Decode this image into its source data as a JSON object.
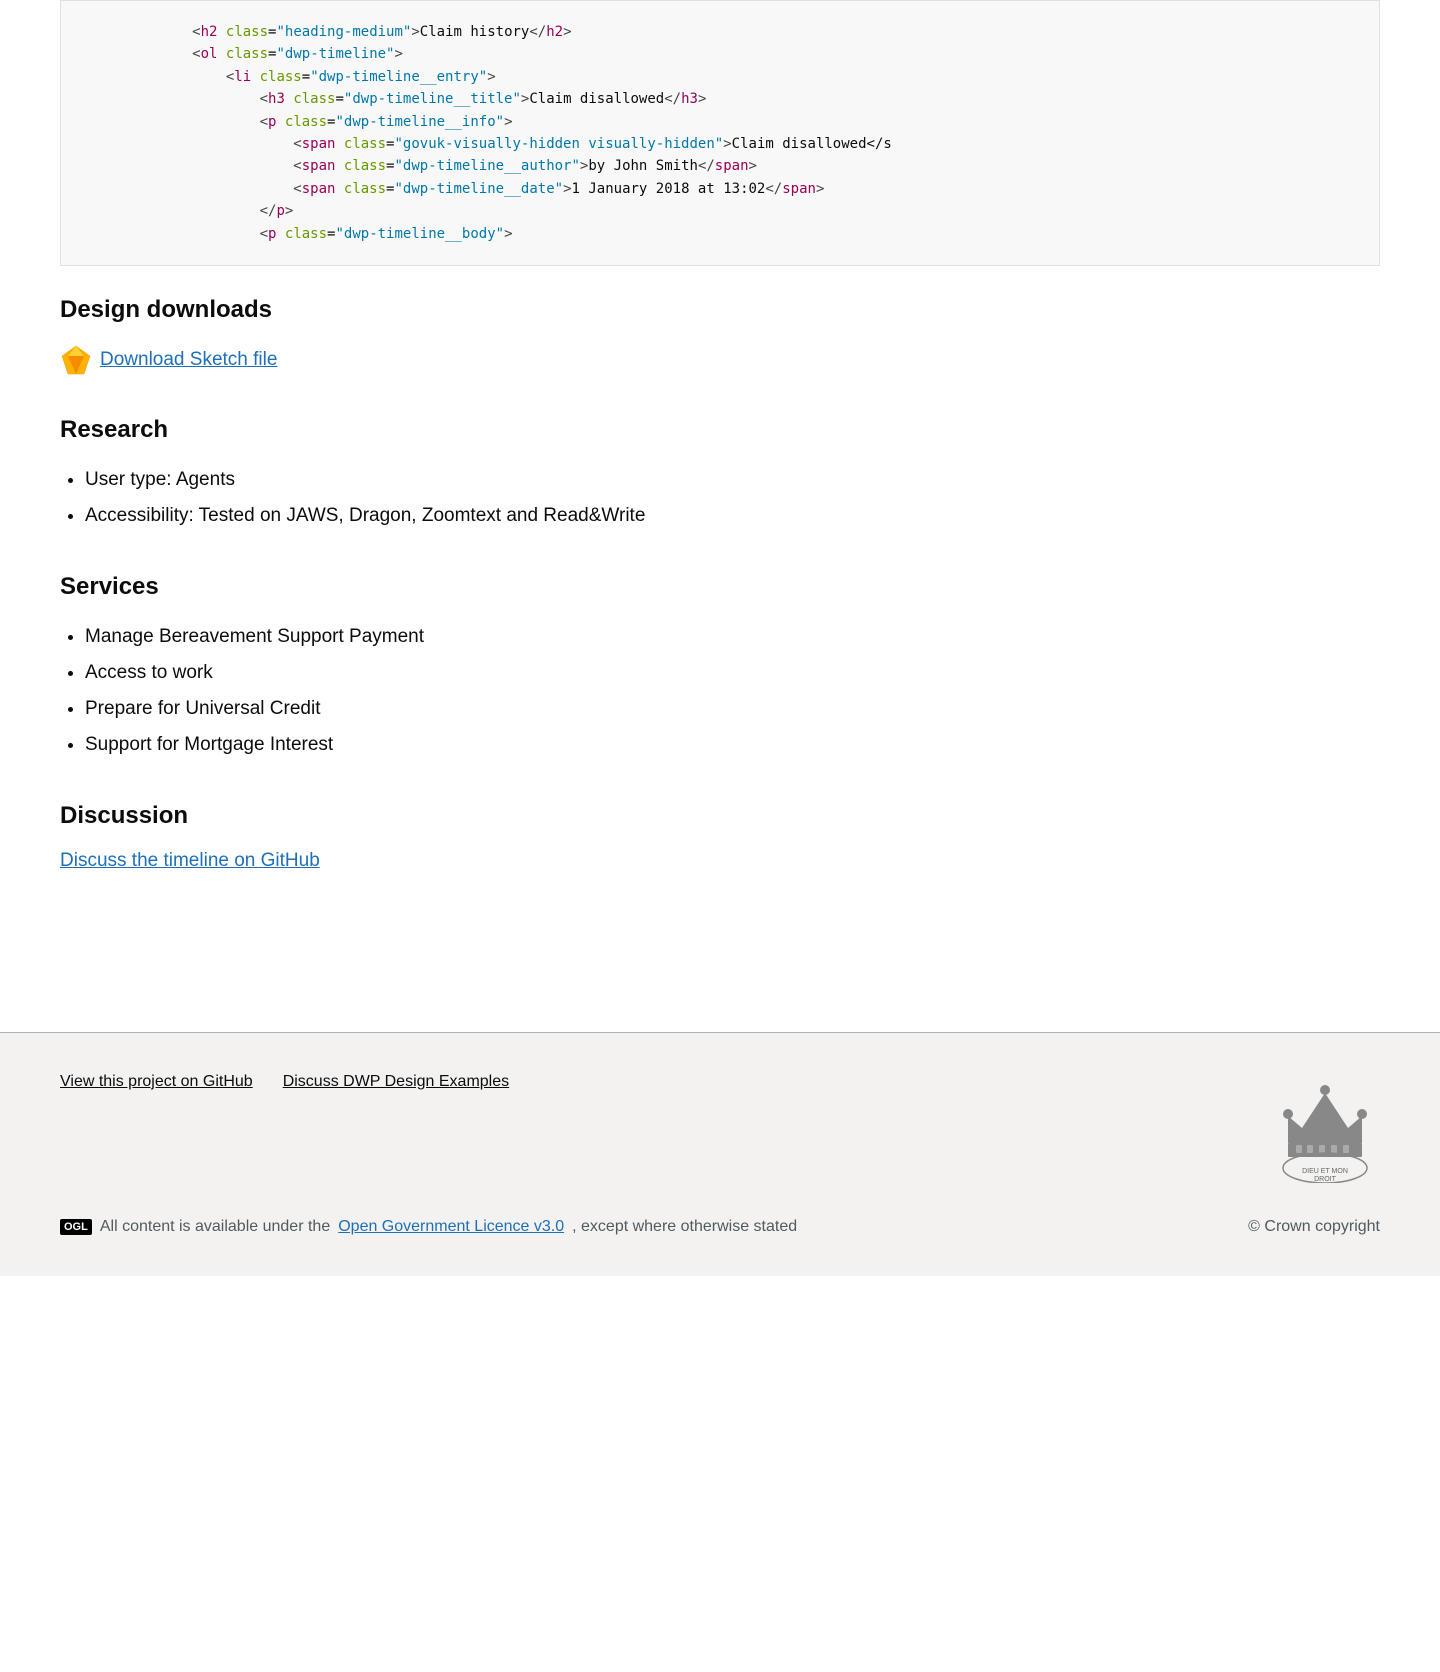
{
  "code_block": {
    "lines": [
      {
        "indent": 12,
        "content": "<h2 class=\"heading-medium\">Claim history</h2>"
      },
      {
        "indent": 12,
        "content": "<ol class=\"dwp-timeline\">"
      },
      {
        "indent": 16,
        "content": "<li class=\"dwp-timeline__entry\">"
      },
      {
        "indent": 20,
        "content": "<h3 class=\"dwp-timeline__title\">Claim disallowed</h3>"
      },
      {
        "indent": 20,
        "content": "<p class=\"dwp-timeline__info\">"
      },
      {
        "indent": 24,
        "content": "<span class=\"govuk-visually-hidden visually-hidden\">Claim disallowed</"
      },
      {
        "indent": 24,
        "content": "<span class=\"dwp-timeline__author\">by John Smith</span>"
      },
      {
        "indent": 24,
        "content": "<span class=\"dwp-timeline__date\">1 January 2018 at 13:02</span>"
      },
      {
        "indent": 20,
        "content": "</p>"
      },
      {
        "indent": 20,
        "content": "<p class=\"dwp-timeline__body\">"
      }
    ]
  },
  "design_downloads": {
    "heading": "Design downloads",
    "sketch_link_text": "Download Sketch file",
    "sketch_icon_label": "sketch-diamond-icon"
  },
  "research": {
    "heading": "Research",
    "items": [
      "User type: Agents",
      "Accessibility: Tested on JAWS, Dragon, Zoomtext and Read&Write"
    ]
  },
  "services": {
    "heading": "Services",
    "items": [
      "Manage Bereavement Support Payment",
      "Access to work",
      "Prepare for Universal Credit",
      "Support for Mortgage Interest"
    ]
  },
  "discussion": {
    "heading": "Discussion",
    "link_text": "Discuss the timeline on GitHub",
    "link_href": "#"
  },
  "footer": {
    "view_github_label": "View this project on GitHub",
    "discuss_dwp_label": "Discuss DWP Design Examples",
    "ogl_label": "OGL",
    "licence_text_before": "All content is available under the",
    "licence_link_text": "Open Government Licence v3.0",
    "licence_text_after": ", except where otherwise stated",
    "crown_copyright": "© Crown copyright"
  },
  "colors": {
    "link": "#1d70b8",
    "text": "#0b0c0c",
    "secondary_text": "#505a5f",
    "footer_bg": "#f3f2f1",
    "code_bg": "#f8f8f8"
  }
}
